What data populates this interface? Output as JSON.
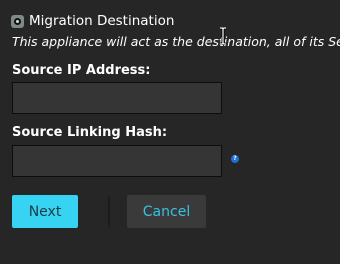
{
  "option": {
    "label": "Migration Destination",
    "description": "This appliance will act as the destination, all of its Setti",
    "selected": true
  },
  "fields": {
    "source_ip": {
      "label": "Source IP Address:",
      "value": "",
      "placeholder": ""
    },
    "source_hash": {
      "label": "Source Linking Hash:",
      "value": "",
      "placeholder": ""
    }
  },
  "help_icon": {
    "icon": "question-circle-icon",
    "glyph": "?",
    "color": "#1f6fd6"
  },
  "buttons": {
    "next": "Next",
    "cancel": "Cancel"
  },
  "colors": {
    "background": "#262626",
    "accent": "#36d4f2",
    "input_bg": "#353535",
    "cancel_bg": "#3a3a3a"
  },
  "cursor": {
    "icon": "text-cursor-icon"
  }
}
